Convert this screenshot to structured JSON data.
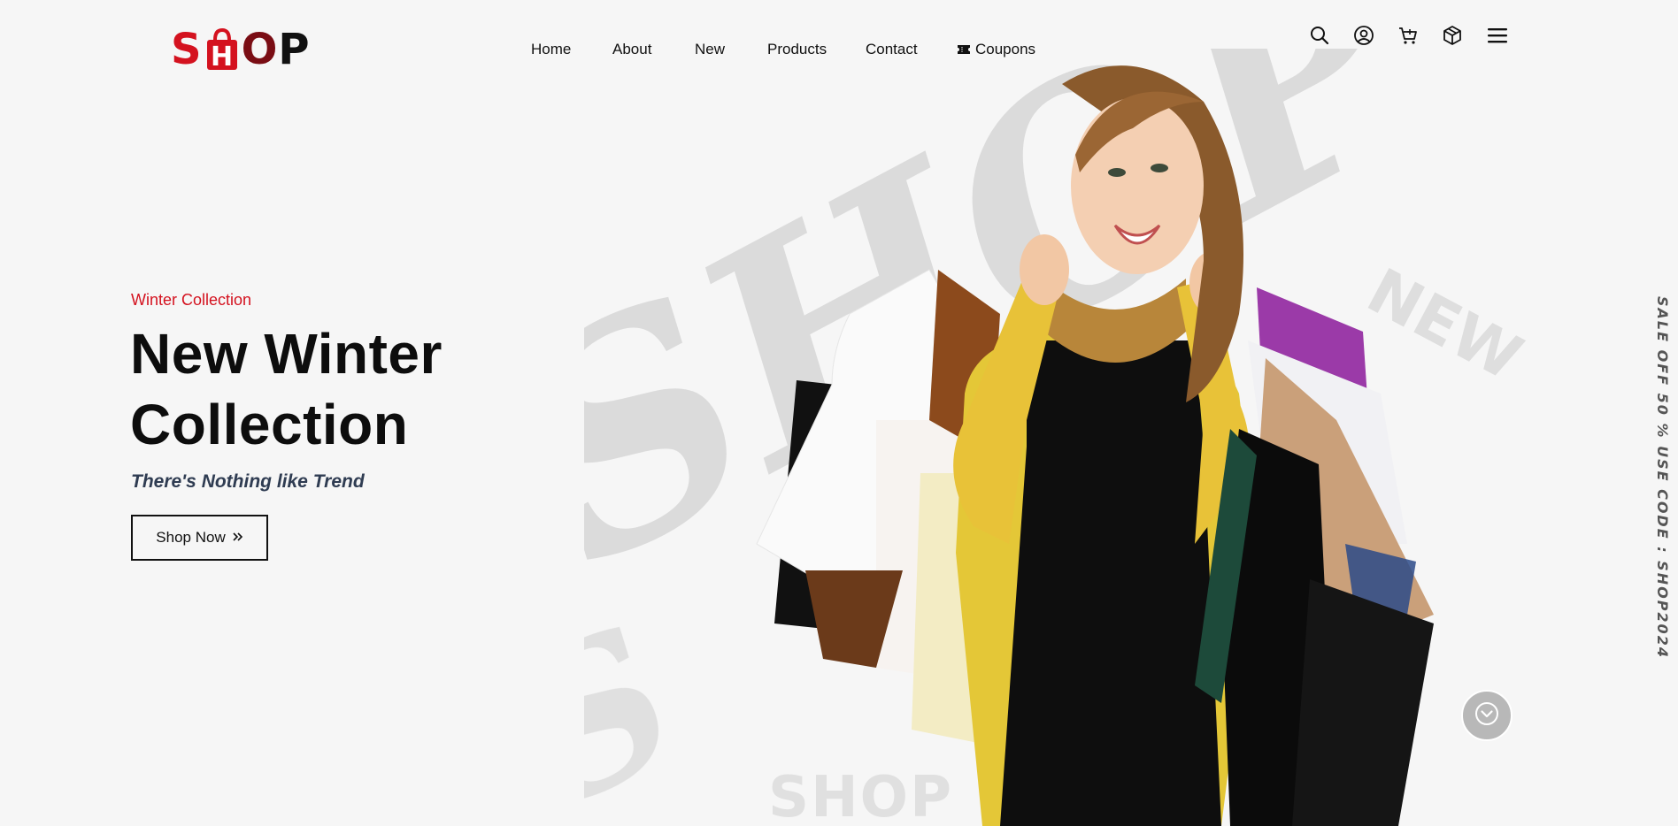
{
  "brand": {
    "logo_letters": [
      "S",
      "H",
      "O",
      "P"
    ],
    "colors": {
      "accent": "#d4121f",
      "dark_red": "#7a0d14",
      "text": "#111111",
      "tagline": "#2f3c52",
      "background": "#f6f6f6"
    }
  },
  "nav": {
    "items": [
      {
        "label": "Home"
      },
      {
        "label": "About"
      },
      {
        "label": "New"
      },
      {
        "label": "Products"
      },
      {
        "label": "Contact"
      },
      {
        "label": "Coupons",
        "icon": "ticket-icon"
      }
    ]
  },
  "header_icons": [
    "search-icon",
    "user-icon",
    "cart-icon",
    "box-icon",
    "menu-icon"
  ],
  "hero": {
    "eyebrow": "Winter Collection",
    "headline_line1": "New Winter",
    "headline_line2": "Collection",
    "tagline": "There's Nothing like Trend",
    "cta_label": "Shop Now",
    "cta_icon": "double-chevron-right-icon",
    "watermark_text": "SHOP",
    "watermark_new": "NEW",
    "bottom_logo": "SHOP"
  },
  "promo": {
    "vertical_text": "SALE OFF 50 % USE  CODE : SHOP2024"
  },
  "scroll_button": {
    "icon": "chevron-down-icon"
  }
}
